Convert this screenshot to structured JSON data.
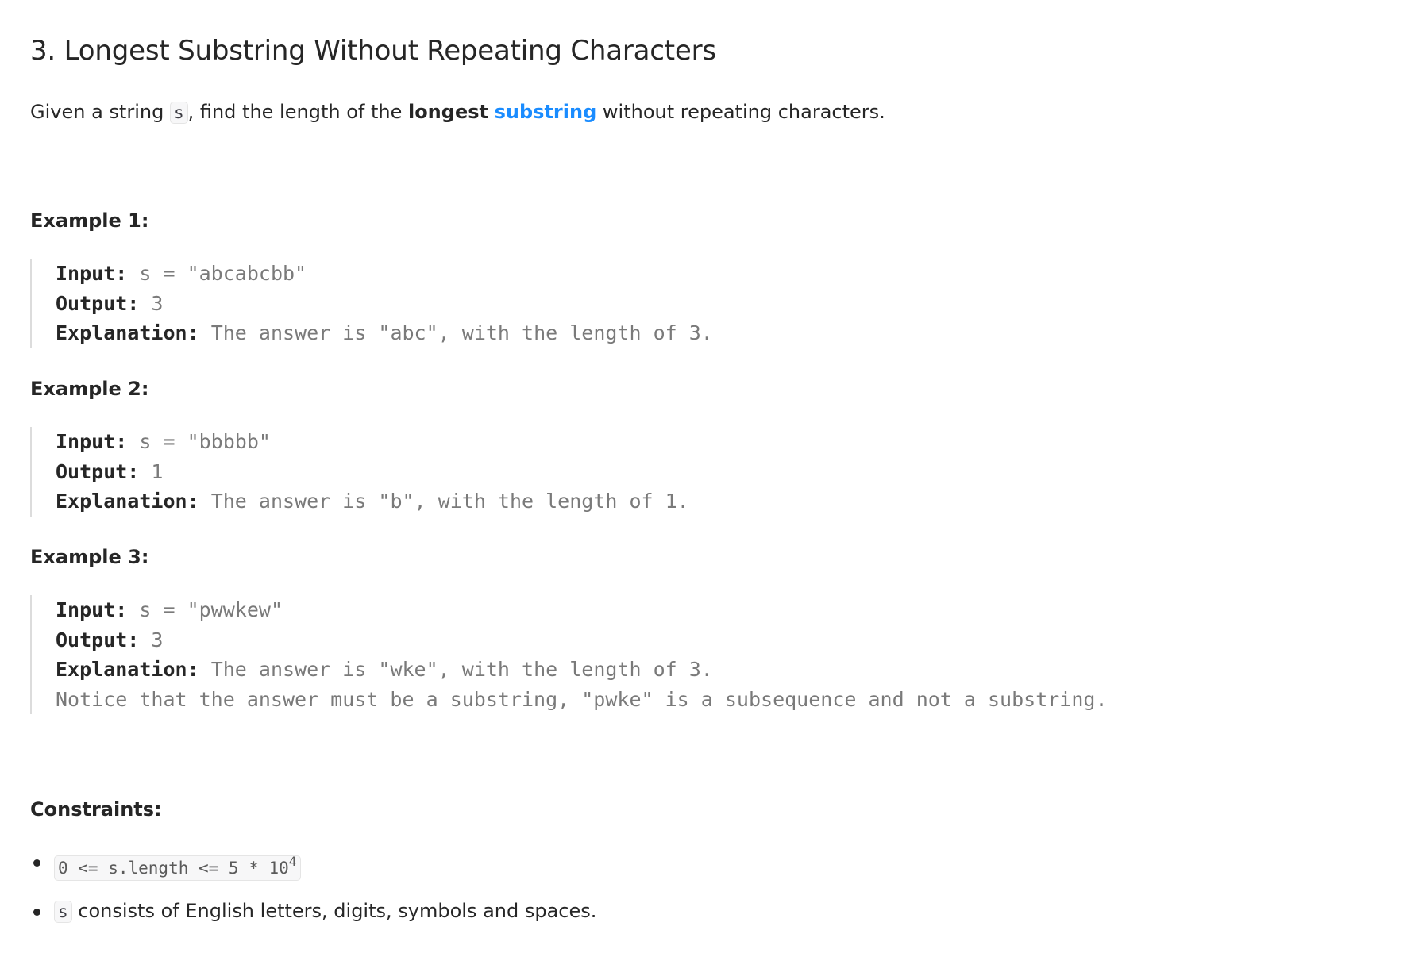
{
  "problem": {
    "title": "3. Longest Substring Without Repeating Characters",
    "description": {
      "part1": "Given a string ",
      "code_s": "s",
      "part2": ", find the length of the ",
      "bold": "longest",
      "link": "substring",
      "part3": " without repeating characters."
    }
  },
  "examples": [
    {
      "title": "Example 1:",
      "input_label": "Input:",
      "input_value": "s = \"abcabcbb\"",
      "output_label": "Output:",
      "output_value": "3",
      "explanation_label": "Explanation:",
      "explanation_value": "The answer is \"abc\", with the length of 3."
    },
    {
      "title": "Example 2:",
      "input_label": "Input:",
      "input_value": "s = \"bbbbb\"",
      "output_label": "Output:",
      "output_value": "1",
      "explanation_label": "Explanation:",
      "explanation_value": "The answer is \"b\", with the length of 1."
    },
    {
      "title": "Example 3:",
      "input_label": "Input:",
      "input_value": "s = \"pwwkew\"",
      "output_label": "Output:",
      "output_value": "3",
      "explanation_label": "Explanation:",
      "explanation_value": "The answer is \"wke\", with the length of 3.",
      "note": "Notice that the answer must be a substring, \"pwke\" is a subsequence and not a substring."
    }
  ],
  "constraints": {
    "title": "Constraints:",
    "item1_code": "0 <= s.length <= 5 * 10",
    "item1_sup": "4",
    "item2_code": "s",
    "item2_text": " consists of English letters, digits, symbols and spaces."
  }
}
